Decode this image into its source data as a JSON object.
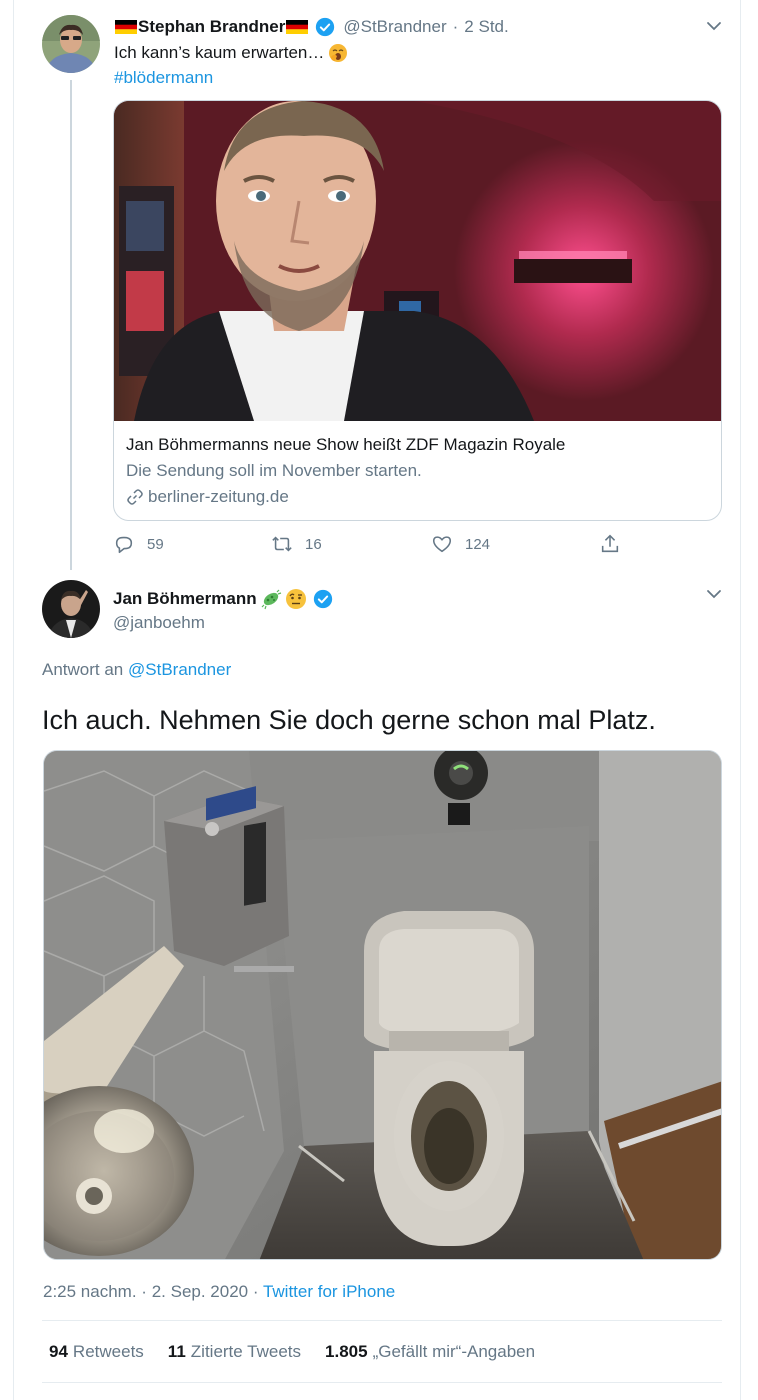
{
  "tweet1": {
    "author_name": "Stephan Brandner",
    "handle": "@StBrandner",
    "separator": "·",
    "time": "2 Std.",
    "text": "Ich kann’s kaum erwarten…",
    "hashtag": "#blödermann",
    "card": {
      "title": "Jan Böhmermanns neue Show heißt ZDF Magazin Royale",
      "description": "Die Sendung soll im November starten.",
      "domain": "berliner-zeitung.de"
    },
    "actions": {
      "replies": "59",
      "retweets": "16",
      "likes": "124"
    }
  },
  "tweet2": {
    "author_name": "Jan Böhmermann",
    "handle": "@janboehm",
    "reply_prefix": "Antwort an",
    "reply_target": "@StBrandner",
    "text": "Ich auch. Nehmen Sie doch gerne schon mal Platz.",
    "time": "2:25 nachm.",
    "date": "2. Sep. 2020",
    "meta_sep": "·",
    "source": "Twitter for iPhone",
    "stats": [
      {
        "count": "94",
        "label": "Retweets"
      },
      {
        "count": "11",
        "label": "Zitierte Tweets"
      },
      {
        "count": "1.805",
        "label": "„Gefällt mir“-Angaben"
      }
    ]
  },
  "colors": {
    "link": "#1b95e0",
    "secondary": "#657786",
    "verified": "#1da1f2"
  }
}
